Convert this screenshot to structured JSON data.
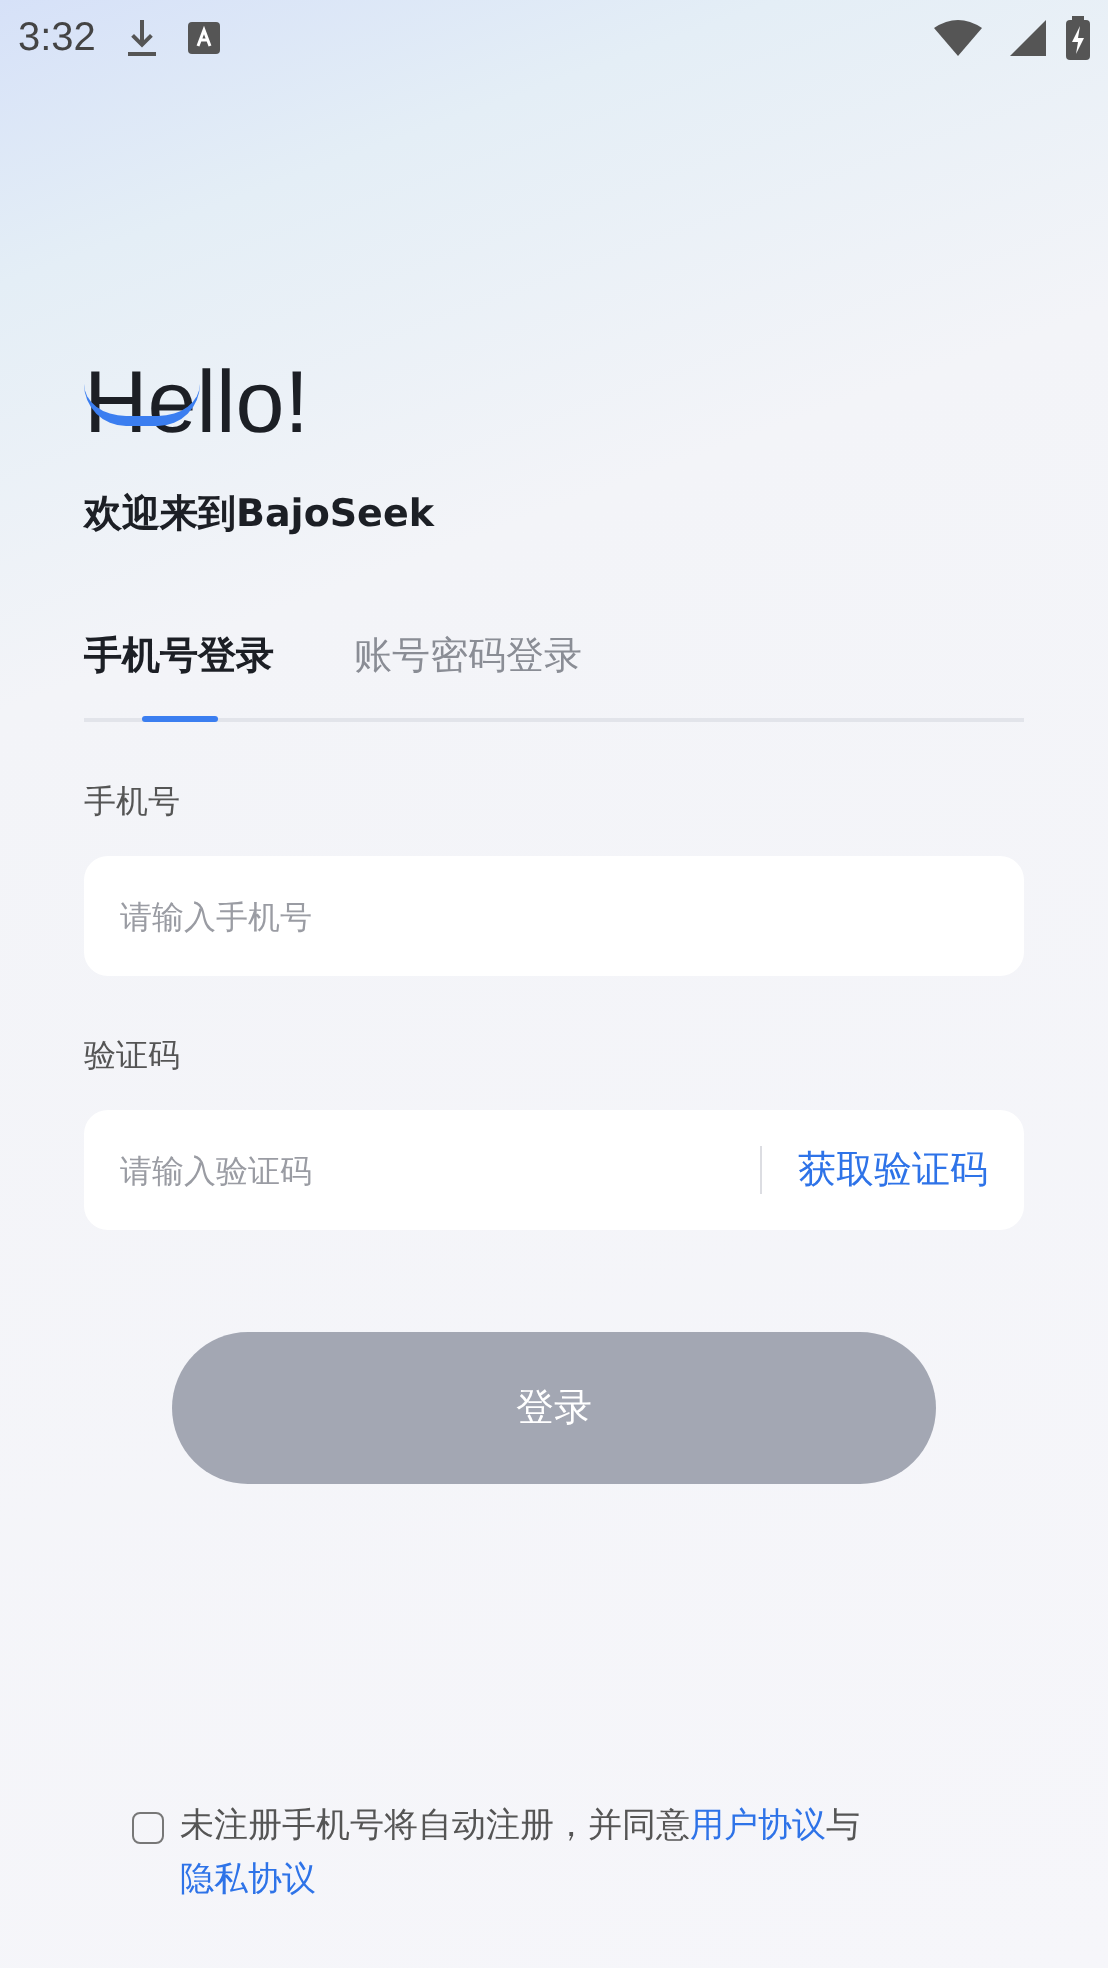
{
  "status_bar": {
    "time": "3:32"
  },
  "greeting": {
    "title": "Hello!",
    "subtitle": "欢迎来到BajoSeek"
  },
  "tabs": [
    {
      "label": "手机号登录",
      "selected": true
    },
    {
      "label": "账号密码登录",
      "selected": false
    }
  ],
  "fields": [
    {
      "label": "手机号",
      "placeholder": "请输入手机号"
    },
    {
      "label": "验证码",
      "placeholder": "请输入验证码",
      "action": "获取验证码"
    }
  ],
  "login_button": {
    "label": "登录",
    "disabled": true
  },
  "agreement": {
    "checked": false,
    "text": "未注册手机号将自动注册，并同意",
    "link_1": "用户协议",
    "joiner": "与",
    "link_2": "隐私协议"
  }
}
